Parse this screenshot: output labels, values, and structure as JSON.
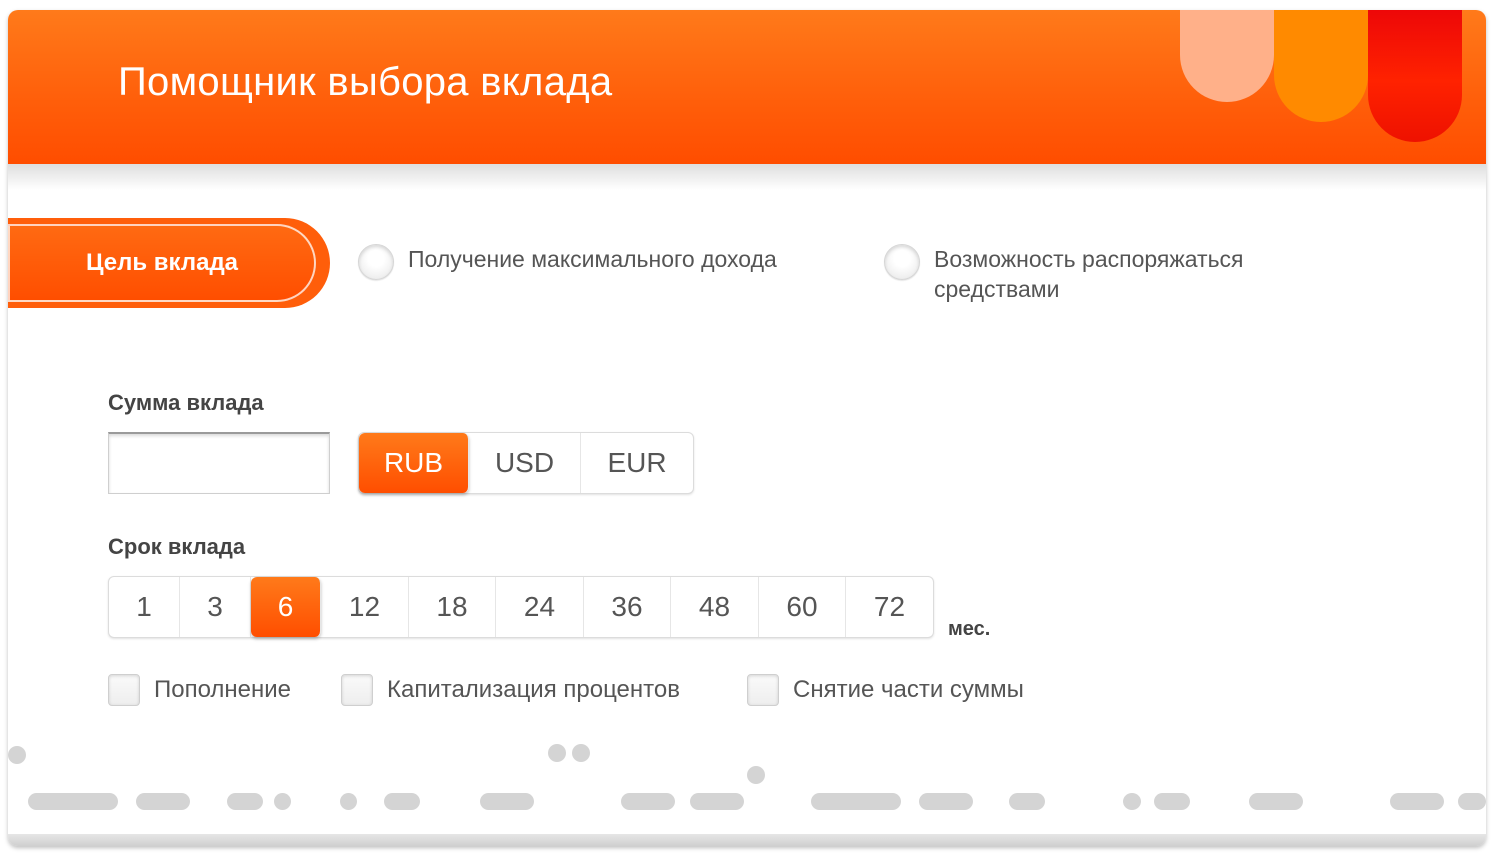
{
  "header": {
    "title": "Помощник выбора вклада"
  },
  "goal": {
    "tab_label": "Цель вклада",
    "options": [
      {
        "label": "Получение максимального дохода",
        "selected": false
      },
      {
        "label": "Возможность распоряжаться средствами",
        "selected": false
      }
    ]
  },
  "amount": {
    "label": "Сумма вклада",
    "value": "",
    "currencies": [
      {
        "label": "RUB",
        "selected": true
      },
      {
        "label": "USD",
        "selected": false
      },
      {
        "label": "EUR",
        "selected": false
      }
    ]
  },
  "term": {
    "label": "Срок вклада",
    "unit": "мес.",
    "options": [
      {
        "label": "1",
        "selected": false
      },
      {
        "label": "3",
        "selected": false
      },
      {
        "label": "6",
        "selected": true
      },
      {
        "label": "12",
        "selected": false
      },
      {
        "label": "18",
        "selected": false
      },
      {
        "label": "24",
        "selected": false
      },
      {
        "label": "36",
        "selected": false
      },
      {
        "label": "48",
        "selected": false
      },
      {
        "label": "60",
        "selected": false
      },
      {
        "label": "72",
        "selected": false
      }
    ]
  },
  "features": [
    {
      "label": "Пополнение",
      "checked": false
    },
    {
      "label": "Капитализация процентов",
      "checked": false
    },
    {
      "label": "Снятие части суммы",
      "checked": false
    }
  ],
  "colors": {
    "accent": "#ff5e0a",
    "accent_dark": "#ff4e00",
    "deco_light": "#ffb089",
    "deco_mid": "#ff8a00",
    "deco_red": "#e8000a"
  }
}
